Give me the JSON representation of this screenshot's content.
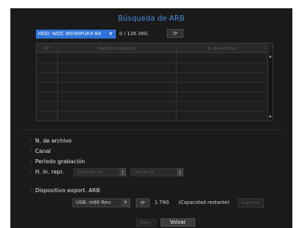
{
  "dialog": {
    "title": "Búsqueda de ARB"
  },
  "hdd": {
    "selected": "HDD: WDC WD40PURX-64",
    "capacity_text": "0  /  126.39G",
    "refresh_icon": "refresh-icon"
  },
  "table": {
    "columns": [
      "Nº",
      "Nombre carpeta",
      "N. de archivo"
    ],
    "rows": []
  },
  "options": {
    "file_no": "N. de archivo",
    "channel": "Canal",
    "period": "Período grabación",
    "start_time_label": "H. in. repr.",
    "start_date": "2016-09-05",
    "start_time": "06:18:12",
    "export_device": "Dispositivo export. ARB"
  },
  "export": {
    "usb_selected": "USB: m80 Rev:",
    "capacity": "1.79G",
    "remaining_label": "(Capacidad restante)",
    "export_label": "Exportar"
  },
  "buttons": {
    "repr": "Repr.",
    "back": "Volver"
  },
  "colors": {
    "accent": "#2f73d6",
    "title": "#4a8ee6",
    "background": "#1a1a1a"
  }
}
